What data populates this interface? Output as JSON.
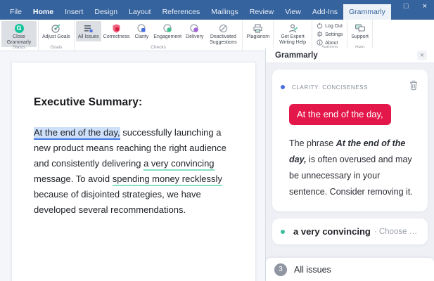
{
  "titlebar": {
    "menu": [
      "File",
      "Home",
      "Insert",
      "Design",
      "Layout",
      "References",
      "Mailings",
      "Review",
      "View",
      "Add-Ins",
      "Grammarly"
    ],
    "active_tab": "Grammarly",
    "controls": {
      "minimize": "–",
      "maximize": "□",
      "close": "×"
    }
  },
  "ribbon": {
    "close_grammarly": "Close Grammarly",
    "adjust_goals": "Adjust Goals",
    "all_issues": "All Issues",
    "correctness": "Correctness",
    "clarity": "Clarity",
    "engagement": "Engagement",
    "delivery": "Delivery",
    "deactivated_suggestions": "Deactivated Suggestions",
    "plagiarism": "Plagiarism",
    "get_expert": "Get Expert Writing Help",
    "log_out": "Log Out",
    "settings": "Settings",
    "about": "About",
    "support": "Support",
    "group_status": "Status",
    "group_goals": "Goals",
    "group_checks": "Checks",
    "group_settings": "Settings",
    "group_help": "Help",
    "icons": {
      "close_grammarly": "grammarly-logo-icon",
      "adjust_goals": "target-icon",
      "all_issues": "list-icon",
      "correctness": "shield-icon",
      "clarity": "circle-blue-icon",
      "engagement": "circle-green-icon",
      "delivery": "circle-purple-icon",
      "deactivated_suggestions": "crossed-circle-icon",
      "plagiarism": "printer-icon",
      "get_expert": "person-check-icon",
      "log_out": "power-icon",
      "settings": "gear-icon",
      "about": "info-icon",
      "support": "chat-bubbles-icon"
    }
  },
  "doc": {
    "heading": "Executive Summary:",
    "p": {
      "hl": "At the end of the day,",
      "l1rest": " successfully launching a",
      "l2": "new product means reaching the right audience",
      "l3pre": "and consistently delivering ",
      "l3u": "a very convincing",
      "l4pre": "message. To avoid ",
      "l4u": "spending money recklessly",
      "l5": "because of disjointed strategies, we have",
      "l6": "developed several recommendations."
    }
  },
  "panel": {
    "title": "Grammarly",
    "close": "×",
    "card": {
      "category": "CLARITY: CONCISENESS",
      "action_button": "At the end of the day,",
      "expl_pre": "The phrase ",
      "expl_bold": "At the end of the day,",
      "expl_post": "  is often overused and may be unnecessary in your sentence. Consider removing it."
    },
    "suggestion": {
      "phrase": "a very convincing",
      "hint": "· Choose a diff..."
    },
    "footer": {
      "count": "3",
      "label": "All issues"
    }
  },
  "colors": {
    "titlebar_blue": "#35639d",
    "grammarly_green": "#15c39a",
    "accent_red": "#e4174a",
    "highlight_blue": "#cfe0fb",
    "underline_blue": "#4077e0",
    "underline_teal": "#82e0c6",
    "clarity_blue": "#4a6ee0",
    "engagement_green": "#3fbf8f",
    "delivery_purple": "#a163d8"
  }
}
